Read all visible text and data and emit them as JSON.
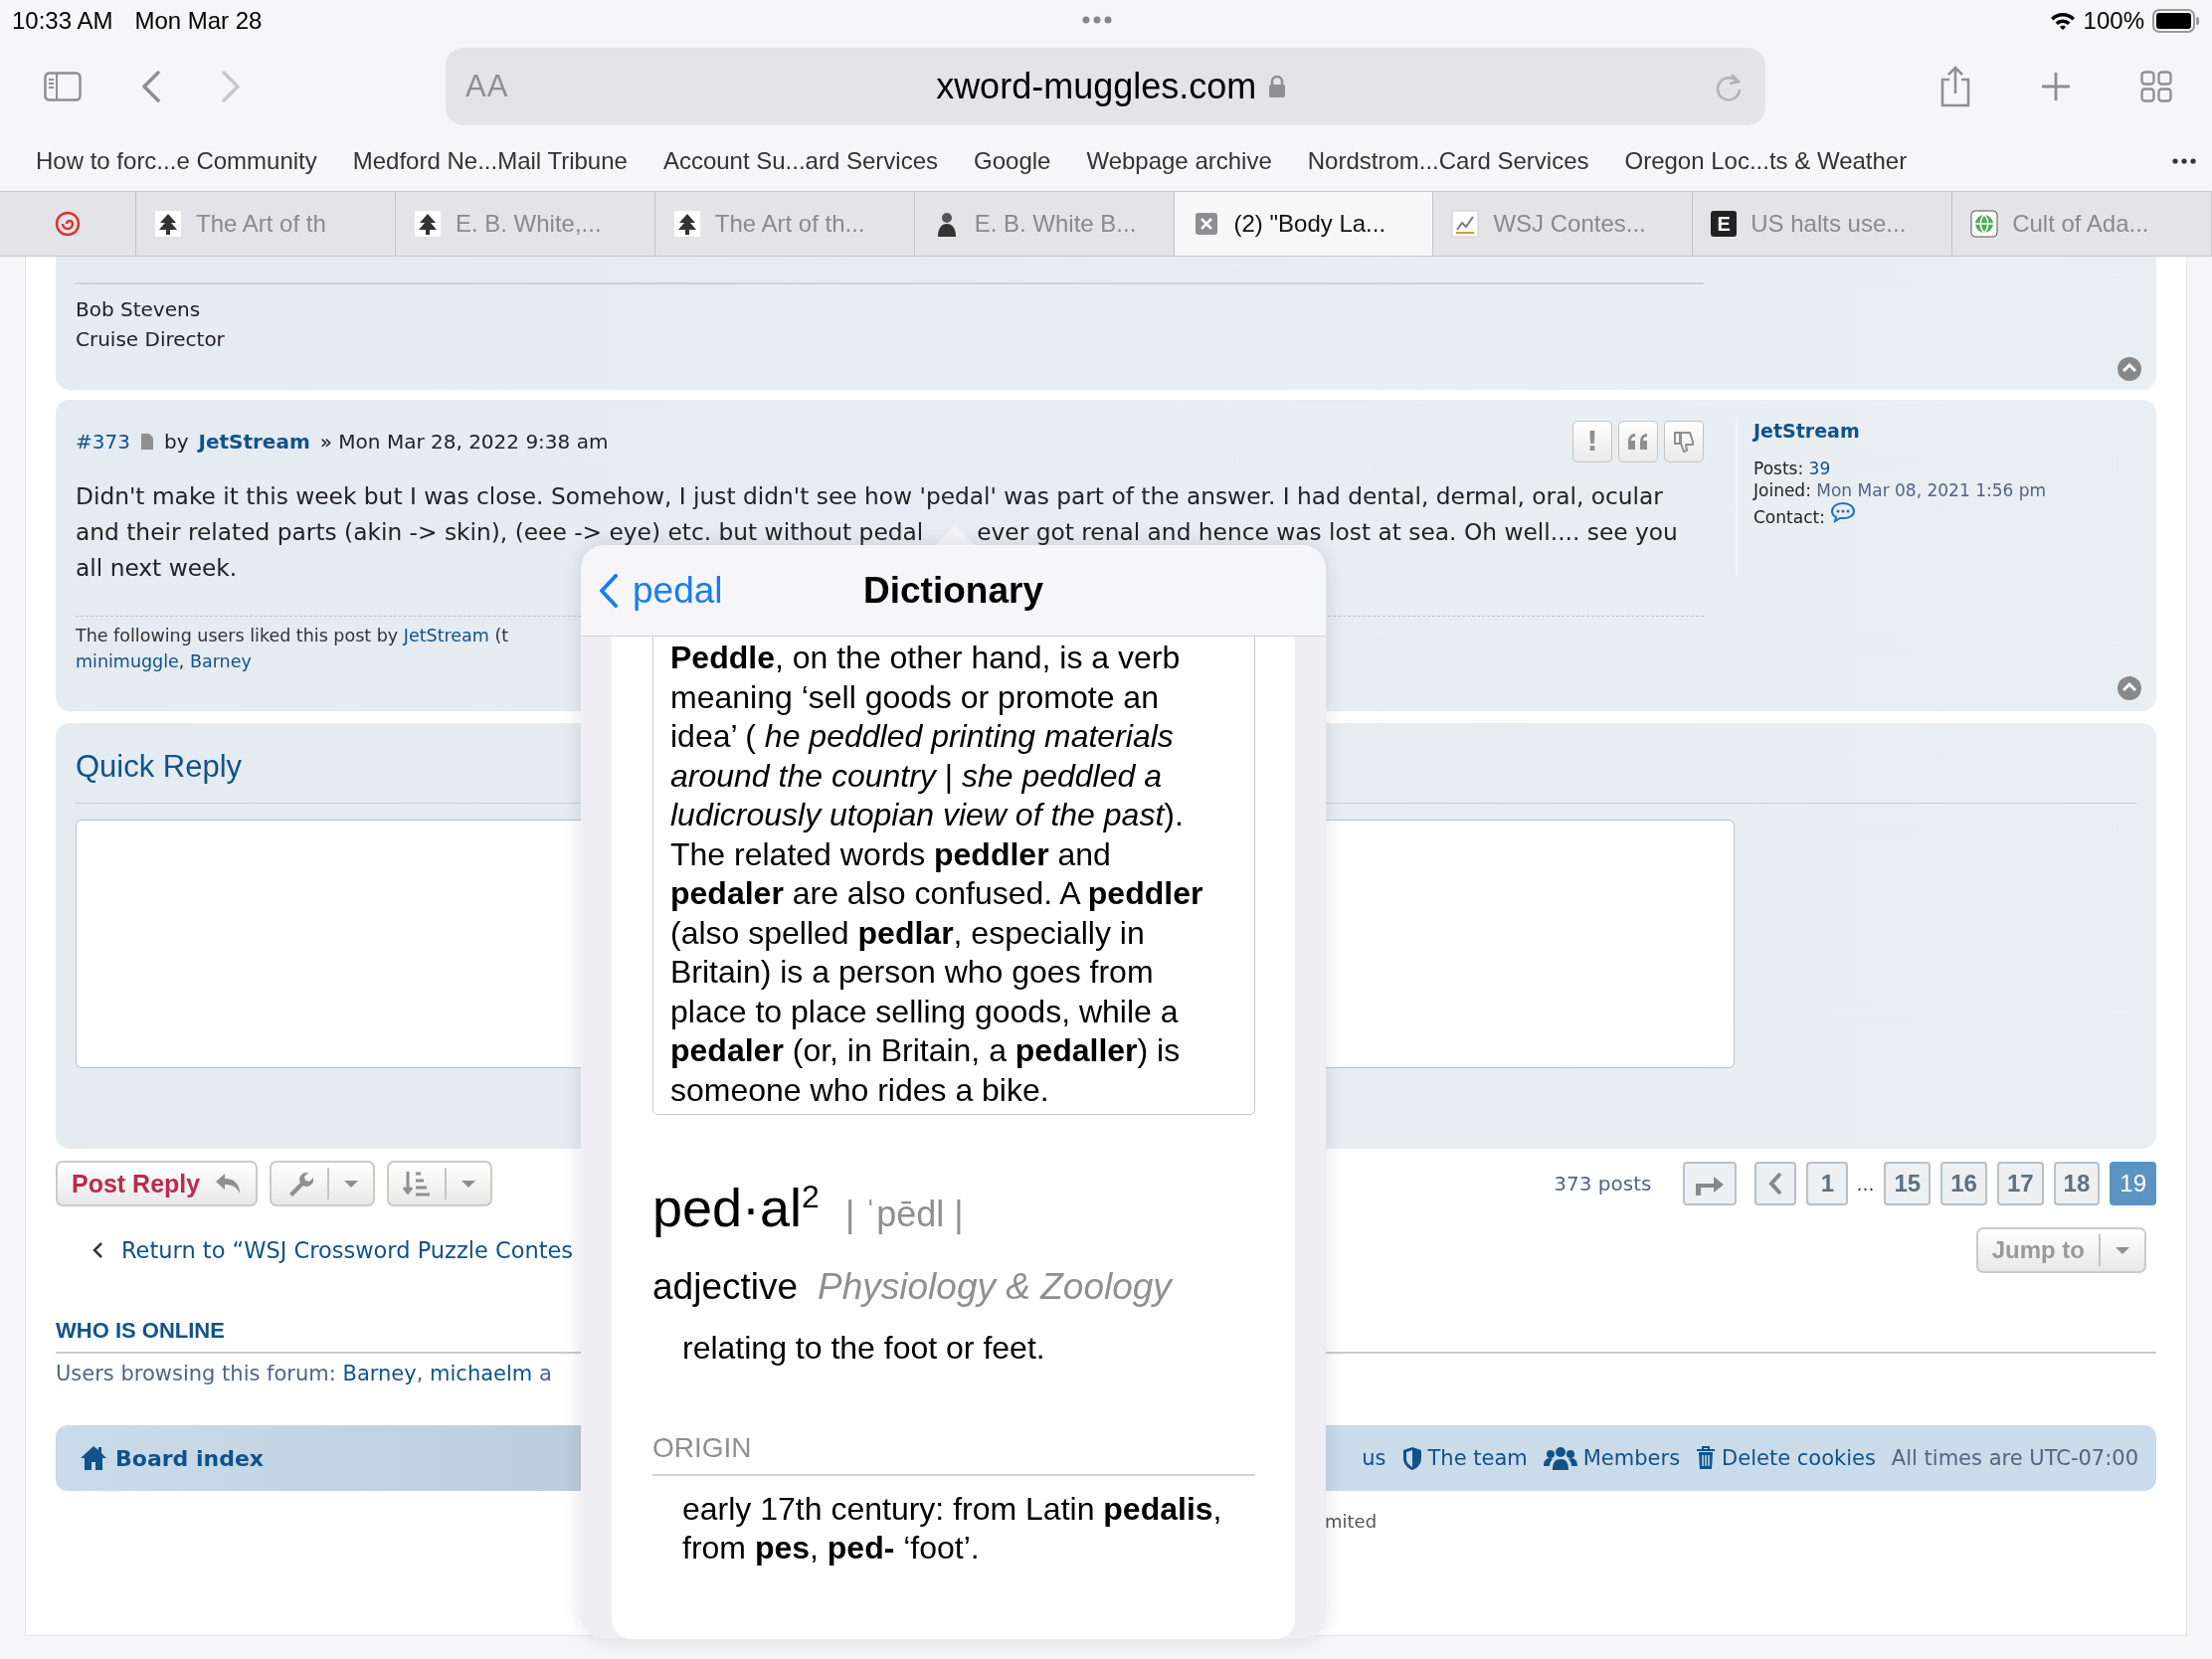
{
  "status_bar": {
    "time": "10:33 AM",
    "date": "Mon Mar 28",
    "battery": "100%"
  },
  "toolbar": {
    "text_size": "AA",
    "url": "xword-muggles.com"
  },
  "bookmarks": [
    "How to forc...e Community",
    "Medford Ne...Mail Tribune",
    "Account Su...ard Services",
    "Google",
    "Webpage archive",
    "Nordstrom...Card Services",
    "Oregon Loc...ts & Weather"
  ],
  "tabs": [
    {
      "kind": "swirl",
      "selected": false
    },
    {
      "title": "The Art of th",
      "kind": "tree",
      "selected": false
    },
    {
      "title": "E. B. White,...",
      "kind": "tree",
      "selected": false
    },
    {
      "title": "The Art of th...",
      "kind": "tree",
      "selected": false
    },
    {
      "title": "E. B. White B...",
      "kind": "person",
      "selected": false
    },
    {
      "title": "(2) \"Body La...",
      "kind": "close",
      "selected": true
    },
    {
      "title": "WSJ Contes...",
      "kind": "chart",
      "selected": false
    },
    {
      "title": "US halts use...",
      "kind": "letter",
      "logo": "E",
      "selected": false
    },
    {
      "title": "Cult of Ada...",
      "kind": "globe",
      "selected": false
    }
  ],
  "previous_post": {
    "signature": [
      "Bob Stevens",
      "Cruise Director"
    ]
  },
  "post": {
    "number": "#373",
    "by": "by",
    "author": "JetStream",
    "date": "» Mon Mar 28, 2022 9:38 am",
    "actions": [
      {
        "kind": "report",
        "label": "!"
      },
      {
        "kind": "quote"
      },
      {
        "kind": "dislike"
      }
    ],
    "body_lines": [
      [
        "Didn't make it this week but I was close. Somehow, I just didn't see how 'pedal' was part of the answer. I had dental, dermal, oral, ocular"
      ],
      [
        "and their related parts (akin -> skin), (eee -> eye) etc. but without pedal",
        "ever got renal and hence was lost at sea. Oh well.... see you"
      ],
      [
        "all next week."
      ]
    ],
    "liked_by": [
      {
        "kind": "text",
        "text": "The following users liked this post by "
      },
      {
        "kind": "link",
        "text": "JetStream"
      },
      {
        "kind": "text",
        "text": " (t"
      }
    ],
    "liked_users": [
      {
        "kind": "link",
        "text": "minimuggle"
      },
      {
        "kind": "text",
        "text": ", "
      },
      {
        "kind": "link",
        "text": "Barney"
      }
    ],
    "profile": {
      "name": "JetStream",
      "fields": [
        {
          "label": "Posts:",
          "value": "39"
        },
        {
          "label": "Joined:",
          "value": "Mon Mar 08, 2021 1:56 pm",
          "kind": "text"
        },
        {
          "label": "Contact:",
          "kind": "contact"
        }
      ]
    }
  },
  "quick_reply": {
    "title": "Quick Reply"
  },
  "post_reply": "Post Reply",
  "pagination": {
    "count": "373 posts",
    "pages": [
      {
        "kind": "page",
        "label": "1",
        "selected": false
      },
      {
        "kind": "ellipsis",
        "label": "…"
      },
      {
        "kind": "page",
        "label": "15",
        "selected": false
      },
      {
        "kind": "page",
        "label": "16",
        "selected": false
      },
      {
        "kind": "page",
        "label": "17",
        "selected": false
      },
      {
        "kind": "page",
        "label": "18",
        "selected": false
      },
      {
        "kind": "page",
        "label": "19",
        "selected": true
      }
    ]
  },
  "return_link": "Return to “WSJ Crossword Puzzle Contes",
  "jump_to": "Jump to",
  "who_is_online": {
    "title": "WHO IS ONLINE",
    "text": [
      {
        "kind": "text",
        "text": "Users browsing this forum: "
      },
      {
        "kind": "link",
        "text": "Barney"
      },
      {
        "kind": "text",
        "text": ", "
      },
      {
        "kind": "link",
        "text": "michaelm"
      },
      {
        "kind": "text",
        "text": " a"
      }
    ]
  },
  "footer": {
    "board_index": "Board index",
    "links": [
      {
        "kind": "plain",
        "label": "us"
      },
      {
        "kind": "shield",
        "label": "The team"
      },
      {
        "kind": "people",
        "label": "Members"
      },
      {
        "kind": "trash",
        "label": "Delete cookies"
      }
    ],
    "timezone": "All times are UTC-07:00"
  },
  "copyright": "mited",
  "dictionary": {
    "back": "pedal",
    "title": "Dictionary",
    "note": "**Peddle**, on the other hand, is a verb meaning ‘sell goods or promote an idea’ ( *he peddled printing materials around the country* | *she peddled a ludicrously utopian view of the past*). The related words **peddler** and **pedaler** are also confused. A **peddler** (also spelled **pedlar**, especially in Britain) is a person who goes from place to place selling goods, while a **pedaler** (or, in Britain, a **pedaller**) is someone who rides a bike.",
    "headword": "ped·al$^{2}$",
    "pronunciation": "| ˈpēdl |",
    "part_of_speech": "adjective",
    "domain": "Physiology & Zoology",
    "definition": "relating to the foot or feet.",
    "origin_label": "ORIGIN",
    "origin": "early 17th century: from Latin **pedalis**, from **pes**, **ped-** ‘foot’."
  }
}
